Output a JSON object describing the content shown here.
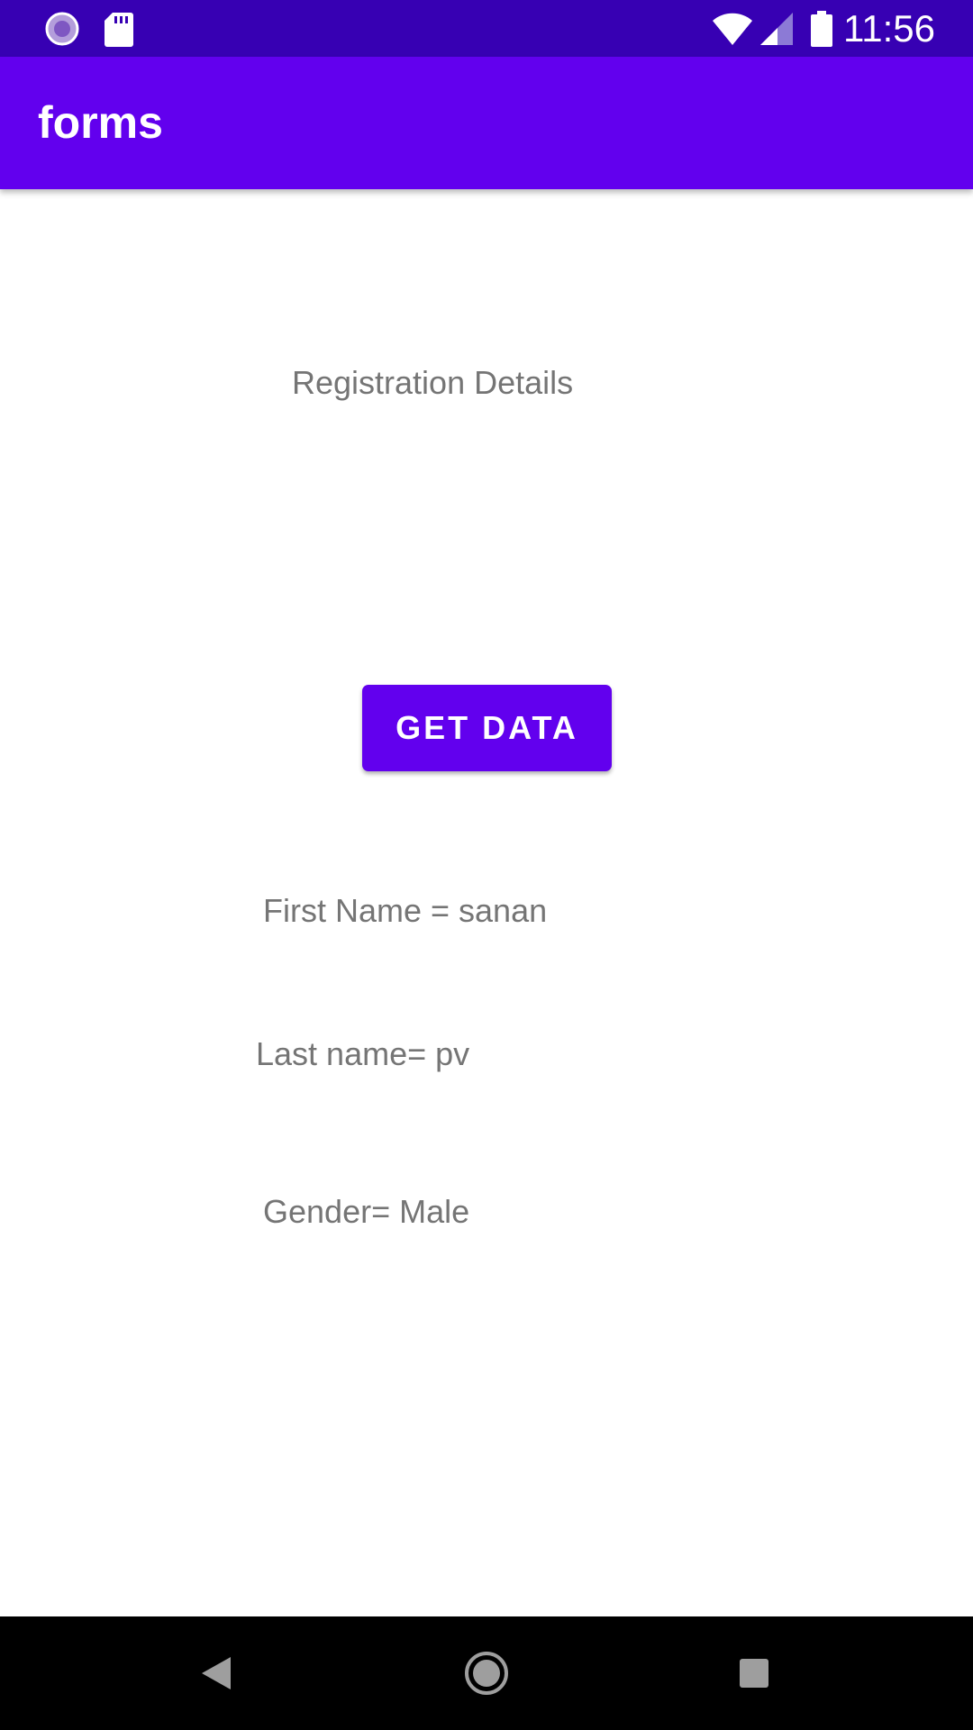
{
  "status_bar": {
    "time": "11:56",
    "icons": [
      "sync-icon",
      "sd-card-icon",
      "wifi-icon",
      "signal-icon",
      "battery-icon"
    ],
    "background": "#3700b3"
  },
  "app_bar": {
    "title": "forms",
    "background": "#6200ee"
  },
  "main": {
    "heading": "Registration Details",
    "get_data_label": "GET DATA",
    "first_name_text": "First Name = sanan",
    "last_name_text": "Last name= pv",
    "gender_text": "Gender= Male",
    "accent": "#6200ee"
  },
  "nav_bar": {
    "buttons": [
      "back-icon",
      "home-icon",
      "recents-icon"
    ]
  }
}
